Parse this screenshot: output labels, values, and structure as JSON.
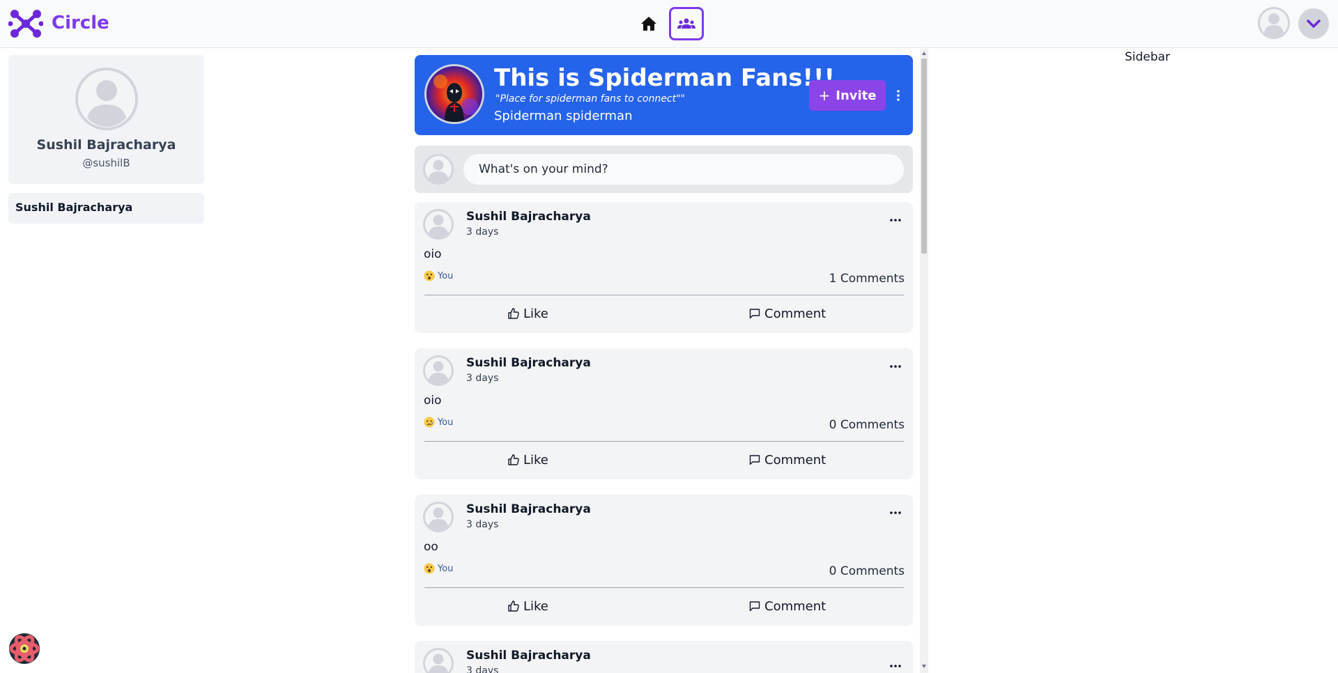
{
  "app": {
    "brand": "Circle",
    "accent": "#7c3aed",
    "header_blue": "#2563eb"
  },
  "topnav": {
    "home_icon": "home-icon",
    "groups_icon": "users-icon",
    "avatar_icon": "user-avatar-icon",
    "menu_icon": "chevron-down-icon"
  },
  "profile": {
    "name": "Sushil Bajracharya",
    "handle": "@sushilB"
  },
  "sidebar_left": {
    "items": [
      {
        "label": "Sushil Bajracharya"
      }
    ]
  },
  "group": {
    "title": "This is Spiderman Fans!!!",
    "description": "\"Place for spiderman fans to connect\"\"",
    "tags": "Spiderman spiderman",
    "invite_label": "Invite"
  },
  "composer": {
    "placeholder": "What's on your mind?"
  },
  "posts": [
    {
      "author": "Sushil Bajracharya",
      "time": "3 days",
      "body": "oio",
      "reaction": "surprised",
      "reaction_label": "You",
      "comments": "1 Comments",
      "like_label": "Like",
      "comment_label": "Comment"
    },
    {
      "author": "Sushil Bajracharya",
      "time": "3 days",
      "body": "oio",
      "reaction": "sad",
      "reaction_label": "You",
      "comments": "0 Comments",
      "like_label": "Like",
      "comment_label": "Comment"
    },
    {
      "author": "Sushil Bajracharya",
      "time": "3 days",
      "body": "oo",
      "reaction": "surprised",
      "reaction_label": "You",
      "comments": "0 Comments",
      "like_label": "Like",
      "comment_label": "Comment"
    },
    {
      "author": "Sushil Bajracharya",
      "time": "3 days",
      "body": "",
      "reaction": "",
      "reaction_label": "",
      "comments": "",
      "like_label": "",
      "comment_label": ""
    }
  ],
  "sidebar_right": {
    "label": "Sidebar"
  }
}
